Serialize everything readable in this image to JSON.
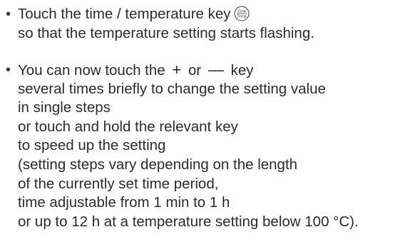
{
  "bullet_symbol": "•",
  "items": [
    {
      "lines": [
        "Touch the time / temperature key",
        "so that the temperature setting starts flashing."
      ],
      "key_icon": {
        "name": "time-temp-key-icon",
        "top_text": "Time",
        "bottom_text": "Temp"
      }
    },
    {
      "line1_part1": "You can now touch the",
      "plus_symbol": "+",
      "line1_part2": "or",
      "minus_symbol": "—",
      "line1_part3": "key",
      "lines": [
        "several times briefly to change the setting value",
        "in single steps",
        "or touch and hold the relevant key",
        "to speed up the setting",
        "(setting steps vary depending on the length",
        "of the currently set time period,",
        "time adjustable from 1 min to 1 h",
        "or up to 12 h at a temperature setting below 100 °C)."
      ]
    }
  ]
}
